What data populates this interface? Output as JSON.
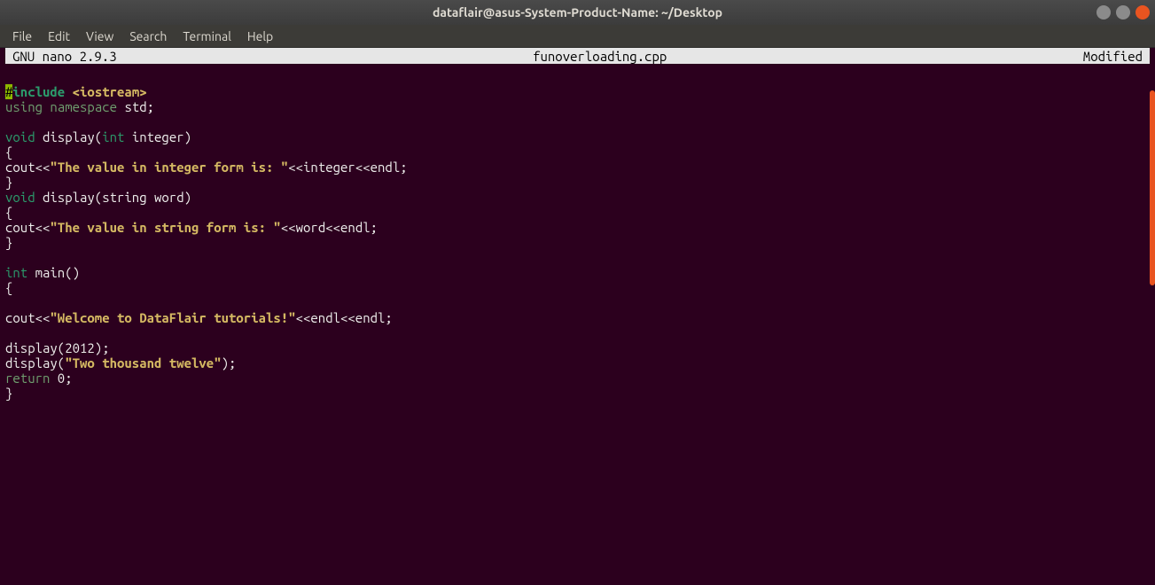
{
  "window": {
    "title": "dataflair@asus-System-Product-Name: ~/Desktop"
  },
  "menubar": {
    "file": "File",
    "edit": "Edit",
    "view": "View",
    "search": "Search",
    "terminal": "Terminal",
    "help": "Help"
  },
  "nano": {
    "version": "  GNU nano 2.9.3",
    "filename": "funoverloading.cpp",
    "status": "Modified  "
  },
  "code": {
    "l1_hash": "#",
    "l1_include": "include",
    "l1_sp": " ",
    "l1_header": "<iostream>",
    "l2_using": "using",
    "l2_sp1": " ",
    "l2_namespace": "namespace",
    "l2_sp2": " ",
    "l2_std": "std;",
    "l4_void": "void",
    "l4_rest": " display(",
    "l4_int": "int",
    "l4_rest2": " integer)",
    "l5": "{",
    "l6_cout": "cout<<",
    "l6_str": "\"The value in integer form is: \"",
    "l6_rest": "<<integer<<endl;",
    "l7": "}",
    "l8_void": "void",
    "l8_rest": " display(string word)",
    "l9": "{",
    "l10_cout": "cout<<",
    "l10_str": "\"The value in string form is: \"",
    "l10_rest": "<<word<<endl;",
    "l11": "}",
    "l13_int": "int",
    "l13_rest": " main()",
    "l14": "{",
    "l16_cout": "cout<<",
    "l16_str": "\"Welcome to DataFlair tutorials!\"",
    "l16_rest": "<<endl<<endl;",
    "l18": "display(2012);",
    "l19_a": "display(",
    "l19_str": "\"Two thousand twelve\"",
    "l19_b": ");",
    "l20_return": "return",
    "l20_rest": " 0;",
    "l21": "}"
  }
}
